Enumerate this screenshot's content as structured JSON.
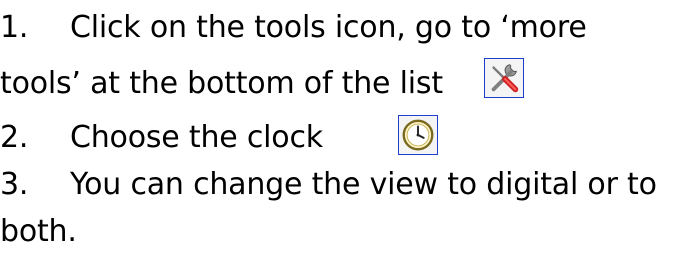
{
  "steps": [
    {
      "number": "1.",
      "text_line1": "Click on the tools icon, go to ‘more",
      "text_line2": "tools’ at the bottom of the list",
      "icon": "tools-icon"
    },
    {
      "number": "2.",
      "text": "Choose the clock",
      "icon": "clock-icon"
    },
    {
      "number": "3.",
      "text_line1": "You can change the view to digital or to",
      "text_line2": "both."
    }
  ],
  "colors": {
    "text": "#000000",
    "icon_border": "#1f3fd0"
  }
}
